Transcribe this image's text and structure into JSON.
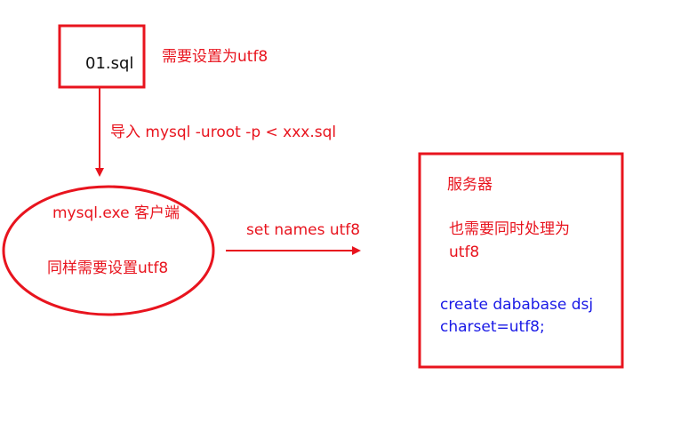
{
  "file_box": {
    "label": "01.sql"
  },
  "file_note": "需要设置为utf8",
  "import_note": "导入  mysql -uroot -p  < xxx.sql",
  "client": {
    "title": "mysql.exe 客户端",
    "note": "同样需要设置utf8"
  },
  "set_names": "set names utf8",
  "server": {
    "title": "服务器",
    "note_line1": "也需要同时处理为",
    "note_line2": "utf8",
    "sql_line1": "create dababase dsj",
    "sql_line2": "charset=utf8;"
  },
  "colors": {
    "diagram_red": "#e8141e",
    "sql_blue": "#1a1ae6"
  }
}
